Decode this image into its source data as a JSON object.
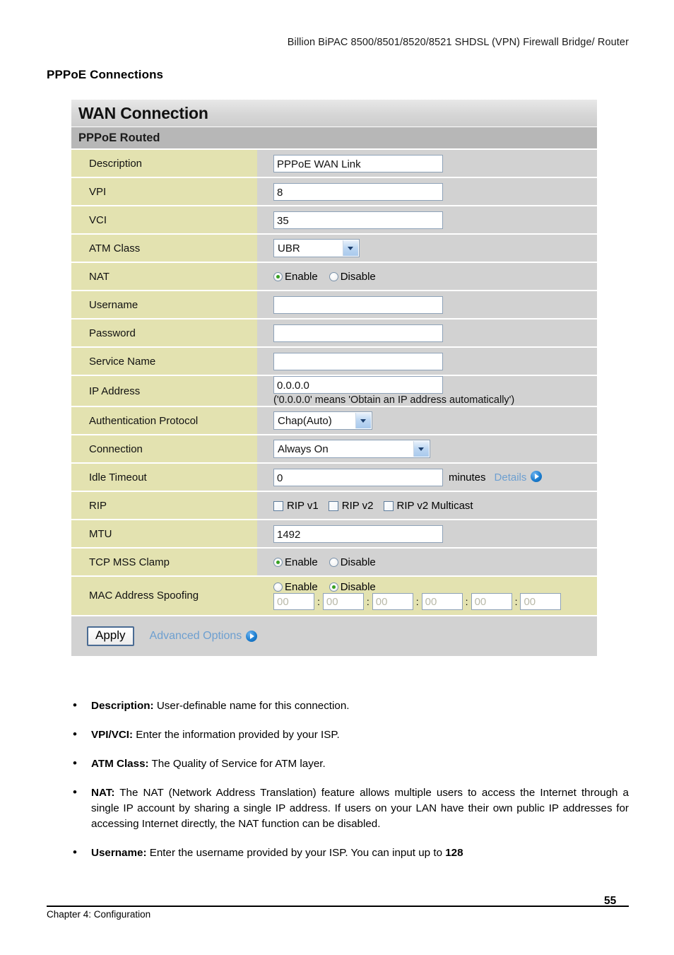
{
  "document": {
    "running_head": "Billion BiPAC 8500/8501/8520/8521 SHDSL (VPN) Firewall Bridge/ Router",
    "section_title": "PPPoE Connections",
    "footer_chapter": "Chapter 4: Configuration",
    "page_number": "55"
  },
  "panel": {
    "title": "WAN Connection",
    "subtitle": "PPPoE Routed",
    "rows": {
      "description": {
        "label": "Description",
        "value": "PPPoE WAN Link"
      },
      "vpi": {
        "label": "VPI",
        "value": "8"
      },
      "vci": {
        "label": "VCI",
        "value": "35"
      },
      "atm_class": {
        "label": "ATM Class",
        "value": "UBR",
        "options": [
          "UBR"
        ]
      },
      "nat": {
        "label": "NAT",
        "enable_label": "Enable",
        "disable_label": "Disable",
        "selected": "Enable"
      },
      "username": {
        "label": "Username",
        "value": "",
        "placeholder": ""
      },
      "password": {
        "label": "Password",
        "value": "",
        "placeholder": ""
      },
      "service_name": {
        "label": "Service Name",
        "value": "",
        "placeholder": ""
      },
      "ip_address": {
        "label": "IP Address",
        "value": "0.0.0.0",
        "hint": "('0.0.0.0' means 'Obtain an IP address automatically')"
      },
      "auth_protocol": {
        "label": "Authentication Protocol",
        "value": "Chap(Auto)",
        "options": [
          "Chap(Auto)"
        ]
      },
      "connection": {
        "label": "Connection",
        "value": "Always On",
        "options": [
          "Always On"
        ]
      },
      "idle_timeout": {
        "label": "Idle Timeout",
        "value": "0",
        "unit": "minutes",
        "details_link": "Details"
      },
      "rip": {
        "label": "RIP",
        "options": [
          {
            "label": "RIP v1",
            "checked": false
          },
          {
            "label": "RIP v2",
            "checked": false
          },
          {
            "label": "RIP v2 Multicast",
            "checked": false
          }
        ]
      },
      "mtu": {
        "label": "MTU",
        "value": "1492"
      },
      "tcp_mss_clamp": {
        "label": "TCP MSS Clamp",
        "enable_label": "Enable",
        "disable_label": "Disable",
        "selected": "Enable"
      },
      "mac_spoofing": {
        "label": "MAC Address Spoofing",
        "enable_label": "Enable",
        "disable_label": "Disable",
        "selected": "Disable",
        "octets": [
          "00",
          "00",
          "00",
          "00",
          "00",
          "00"
        ],
        "separator": ":"
      }
    },
    "footer": {
      "apply_label": "Apply",
      "advanced_options_label": "Advanced Options"
    }
  },
  "bullets": [
    {
      "term": "Description:",
      "text": " User-definable name for this connection."
    },
    {
      "term": "VPI/VCI:",
      "text": " Enter the information provided by your ISP."
    },
    {
      "term": "ATM Class:",
      "text": " The Quality of Service for ATM layer."
    },
    {
      "term": "NAT:",
      "text": " The NAT (Network Address Translation) feature allows multiple users to access the Internet through a single IP account by sharing a single IP address. If users on your LAN have their own public IP addresses for accessing Internet directly, the NAT function can be disabled."
    },
    {
      "term": "Username:",
      "text": " Enter the username provided by your ISP. You can input up to ",
      "tail_bold": "128"
    }
  ],
  "colors": {
    "label_bg": "#e3e2b0",
    "value_bg": "#d2d2d2",
    "subtitle_bg": "#b7b7b7",
    "link_blue": "#6d9fd0",
    "radio_dot_green": "#36a020"
  }
}
